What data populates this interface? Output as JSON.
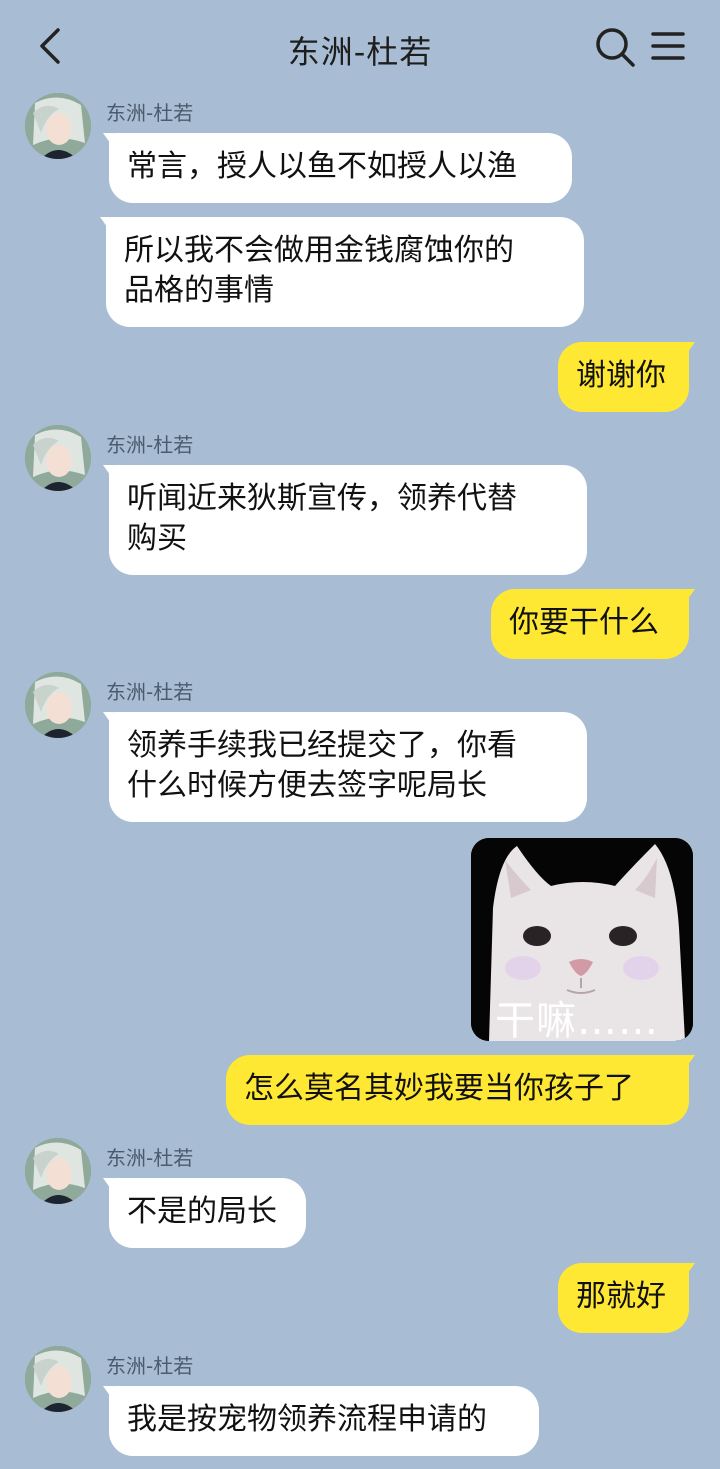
{
  "header": {
    "title": "东洲-杜若"
  },
  "contact": {
    "name": "东洲-杜若"
  },
  "messages": [
    {
      "from": "them",
      "text": "常言，授人以鱼不如授人以渔"
    },
    {
      "from": "them",
      "text": "所以我不会做用金钱腐蚀你的\n品格的事情"
    },
    {
      "from": "me",
      "text": "谢谢你"
    },
    {
      "from": "them",
      "text": "听闻近来狄斯宣传，领养代替\n购买"
    },
    {
      "from": "me",
      "text": "你要干什么"
    },
    {
      "from": "them",
      "text": "领养手续我已经提交了，你看\n什么时候方便去签字呢局长"
    },
    {
      "from": "me",
      "type": "sticker",
      "caption": "干嘛……"
    },
    {
      "from": "me",
      "text": "怎么莫名其妙我要当你孩子了"
    },
    {
      "from": "them",
      "text": "不是的局长"
    },
    {
      "from": "me",
      "text": "那就好"
    },
    {
      "from": "them",
      "text": "我是按宠物领养流程申请的"
    }
  ],
  "colors": {
    "background": "#a8bdd3",
    "outgoing_bubble": "#ffe834",
    "incoming_bubble": "#ffffff"
  }
}
